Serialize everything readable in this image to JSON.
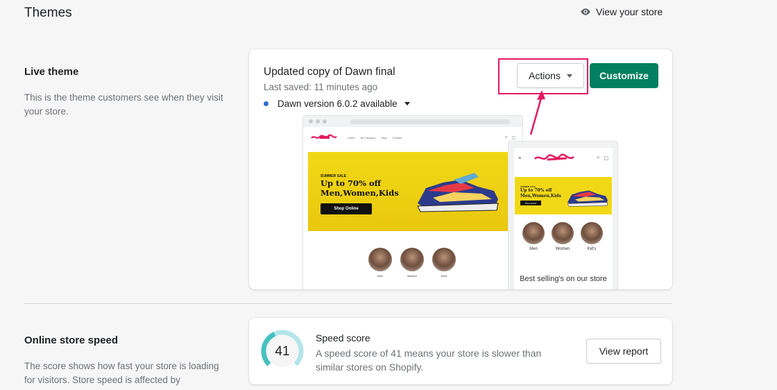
{
  "header": {
    "title": "Themes",
    "view_store_label": "View your store"
  },
  "live_theme": {
    "section_title": "Live theme",
    "section_desc": "This is the theme customers see when they visit your store.",
    "theme_name": "Updated copy of Dawn final",
    "last_saved": "Last saved: 11 minutes ago",
    "version_notice": "Dawn version 6.0.2 available",
    "actions_label": "Actions",
    "customize_label": "Customize",
    "preview": {
      "desktop_nav_links": [
        "Home",
        "All Category",
        "Blog",
        "Contact"
      ],
      "hero_small": "SUMMER SALE",
      "hero_line1": "Up to 70% off",
      "hero_line2": "Men,Women,Kids",
      "hero_button": "Shop Online",
      "categories": [
        "Men",
        "Women",
        "Kid's"
      ],
      "best_selling": "Best selling's on our store"
    }
  },
  "speed": {
    "section_title": "Online store speed",
    "section_desc": "The score shows how fast your store is loading for visitors. Store speed is affected by",
    "score": 41,
    "score_title": "Speed score",
    "score_desc": "A speed score of 41 means your store is slower than similar stores on Shopify.",
    "report_label": "View report"
  },
  "colors": {
    "primary": "#008060",
    "highlight": "#e5195f",
    "dot": "#2c6ecb",
    "gauge": "#47c1bf"
  }
}
